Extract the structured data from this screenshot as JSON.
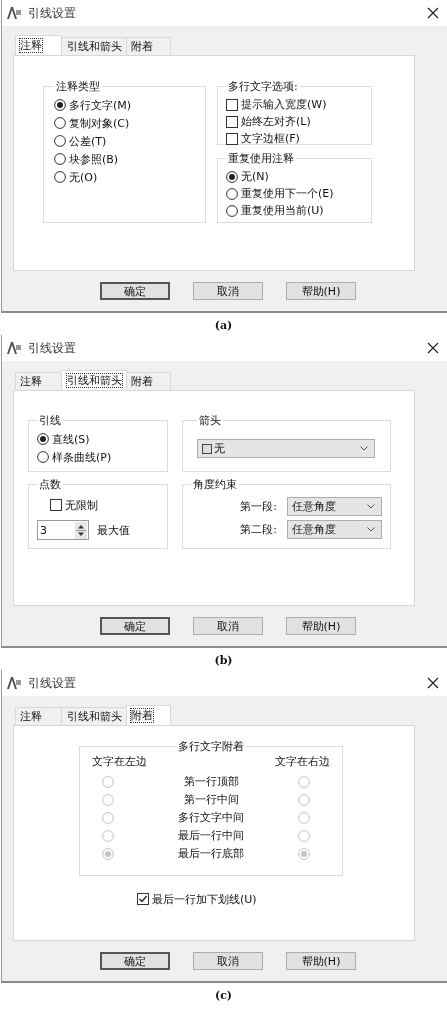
{
  "figures": [
    {
      "kind": "annotation",
      "caption": "(a)",
      "window": {
        "title": "引线设置"
      },
      "tabs": [
        {
          "label": "注释",
          "selected": true
        },
        {
          "label": "引线和箭头",
          "selected": false
        },
        {
          "label": "附着",
          "selected": false
        }
      ],
      "annotation_type": {
        "title": "注释类型",
        "options": [
          {
            "label": "多行文字(M)",
            "selected": true
          },
          {
            "label": "复制对象(C)",
            "selected": false
          },
          {
            "label": "公差(T)",
            "selected": false
          },
          {
            "label": "块参照(B)",
            "selected": false
          },
          {
            "label": "无(O)",
            "selected": false
          }
        ]
      },
      "mtext_options": {
        "title": "多行文字选项:",
        "checkboxes": [
          {
            "label": "提示输入宽度(W)",
            "checked": false
          },
          {
            "label": "始终左对齐(L)",
            "checked": false
          },
          {
            "label": "文字边框(F)",
            "checked": false
          }
        ]
      },
      "reuse": {
        "title": "重复使用注释",
        "options": [
          {
            "label": "无(N)",
            "selected": true
          },
          {
            "label": "重复使用下一个(E)",
            "selected": false
          },
          {
            "label": "重复使用当前(U)",
            "selected": false
          }
        ]
      },
      "buttons": [
        {
          "label": "确定",
          "default": true
        },
        {
          "label": "取消",
          "default": false
        },
        {
          "label": "帮助(H)",
          "default": false
        }
      ]
    },
    {
      "kind": "leader",
      "caption": "(b)",
      "window": {
        "title": "引线设置"
      },
      "tabs": [
        {
          "label": "注释",
          "selected": false
        },
        {
          "label": "引线和箭头",
          "selected": true
        },
        {
          "label": "附着",
          "selected": false
        }
      ],
      "leader": {
        "title": "引线",
        "options": [
          {
            "label": "直线(S)",
            "selected": true
          },
          {
            "label": "样条曲线(P)",
            "selected": false
          }
        ]
      },
      "arrow": {
        "title": "箭头",
        "value": "无"
      },
      "points": {
        "title": "点数",
        "unlimited": {
          "label": "无限制",
          "checked": false
        },
        "max_value": "3",
        "max_label": "最大值"
      },
      "angle": {
        "title": "角度约束",
        "rows": [
          {
            "label": "第一段:",
            "value": "任意角度"
          },
          {
            "label": "第二段:",
            "value": "任意角度"
          }
        ]
      },
      "buttons": [
        {
          "label": "确定",
          "default": true
        },
        {
          "label": "取消",
          "default": false
        },
        {
          "label": "帮助(H)",
          "default": false
        }
      ]
    },
    {
      "kind": "attachment",
      "caption": "(c)",
      "window": {
        "title": "引线设置"
      },
      "tabs": [
        {
          "label": "注释",
          "selected": false
        },
        {
          "label": "引线和箭头",
          "selected": false
        },
        {
          "label": "附着",
          "selected": true
        }
      ],
      "attach": {
        "title": "多行文字附着",
        "disabled": true,
        "left_header": "文字在左边",
        "right_header": "文字在右边",
        "rows": [
          {
            "label": "第一行顶部",
            "left_selected": false,
            "right_selected": false
          },
          {
            "label": "第一行中间",
            "left_selected": false,
            "right_selected": false
          },
          {
            "label": "多行文字中间",
            "left_selected": false,
            "right_selected": false
          },
          {
            "label": "最后一行中间",
            "left_selected": false,
            "right_selected": false
          },
          {
            "label": "最后一行底部",
            "left_selected": true,
            "right_selected": true
          }
        ]
      },
      "underline": {
        "label": "最后一行加下划线(U)",
        "checked": true
      },
      "buttons": [
        {
          "label": "确定",
          "default": true
        },
        {
          "label": "取消",
          "default": false
        },
        {
          "label": "帮助(H)",
          "default": false
        }
      ]
    }
  ]
}
